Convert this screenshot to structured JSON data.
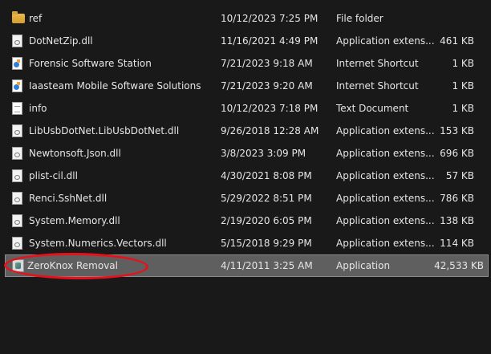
{
  "files": [
    {
      "name": "ref",
      "date": "10/12/2023 7:25 PM",
      "type": "File folder",
      "size": "",
      "icon": "folder-icon",
      "selected": false
    },
    {
      "name": "DotNetZip.dll",
      "date": "11/16/2021 4:49 PM",
      "type": "Application extens...",
      "size": "461 KB",
      "icon": "dll-icon",
      "selected": false
    },
    {
      "name": "Forensic Software Station",
      "date": "7/21/2023 9:18 AM",
      "type": "Internet Shortcut",
      "size": "1 KB",
      "icon": "shortcut-icon",
      "selected": false
    },
    {
      "name": "Iaasteam Mobile Software Solutions",
      "date": "7/21/2023 9:20 AM",
      "type": "Internet Shortcut",
      "size": "1 KB",
      "icon": "shortcut-icon",
      "selected": false
    },
    {
      "name": "info",
      "date": "10/12/2023 7:18 PM",
      "type": "Text Document",
      "size": "1 KB",
      "icon": "text-document-icon",
      "selected": false
    },
    {
      "name": "LibUsbDotNet.LibUsbDotNet.dll",
      "date": "9/26/2018 12:28 AM",
      "type": "Application extens...",
      "size": "153 KB",
      "icon": "dll-icon",
      "selected": false
    },
    {
      "name": "Newtonsoft.Json.dll",
      "date": "3/8/2023 3:09 PM",
      "type": "Application extens...",
      "size": "696 KB",
      "icon": "dll-icon",
      "selected": false
    },
    {
      "name": "plist-cil.dll",
      "date": "4/30/2021 8:08 PM",
      "type": "Application extens...",
      "size": "57 KB",
      "icon": "dll-icon",
      "selected": false
    },
    {
      "name": "Renci.SshNet.dll",
      "date": "5/29/2022 8:51 PM",
      "type": "Application extens...",
      "size": "786 KB",
      "icon": "dll-icon",
      "selected": false
    },
    {
      "name": "System.Memory.dll",
      "date": "2/19/2020 6:05 PM",
      "type": "Application extens...",
      "size": "138 KB",
      "icon": "dll-icon",
      "selected": false
    },
    {
      "name": "System.Numerics.Vectors.dll",
      "date": "5/15/2018 9:29 PM",
      "type": "Application extens...",
      "size": "114 KB",
      "icon": "dll-icon",
      "selected": false
    },
    {
      "name": "ZeroKnox Removal",
      "date": "4/11/2011 3:25 AM",
      "type": "Application",
      "size": "42,533 KB",
      "icon": "application-icon",
      "selected": true
    }
  ],
  "colors": {
    "background": "#191919",
    "text": "#e6e6e6",
    "selection": "#5f5f5f",
    "annotation": "#e8101b"
  }
}
